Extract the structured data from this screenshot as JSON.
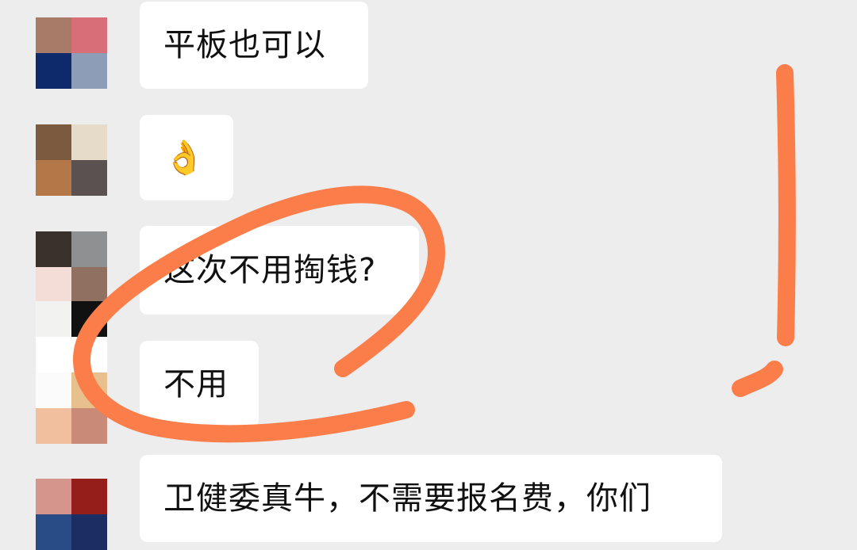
{
  "messages": [
    {
      "avatar_colors": [
        "#a77b68",
        "#d86f76",
        "#0e2a6b",
        "#8e9db7"
      ],
      "text": "平板也可以"
    },
    {
      "avatar_colors": [
        "#7b5a40",
        "#e6dac8",
        "#b47748",
        "#5a5150"
      ],
      "text": "👌"
    },
    {
      "avatar_colors": [
        "#3a312d",
        "#8f9092",
        "#f4ddd7",
        "#907060"
      ],
      "text": "这次不用掏钱?"
    },
    {
      "avatar_colors": [
        "#f2f2f0",
        "#111111",
        "#ffffff",
        "#ffffff"
      ],
      "text": "不用"
    },
    {
      "avatar_colors": [
        "#fbfbfb",
        "#e8c08d",
        "#f2bf9e",
        "#c98b77"
      ],
      "text": ""
    },
    {
      "avatar_colors": [
        "#d6958c",
        "#951d1a",
        "#2a4c86",
        "#1b2e63"
      ],
      "text": "卫健委真牛，不需要报名费，你们"
    }
  ],
  "annotation": {
    "stroke_color": "#fb7e4a"
  }
}
